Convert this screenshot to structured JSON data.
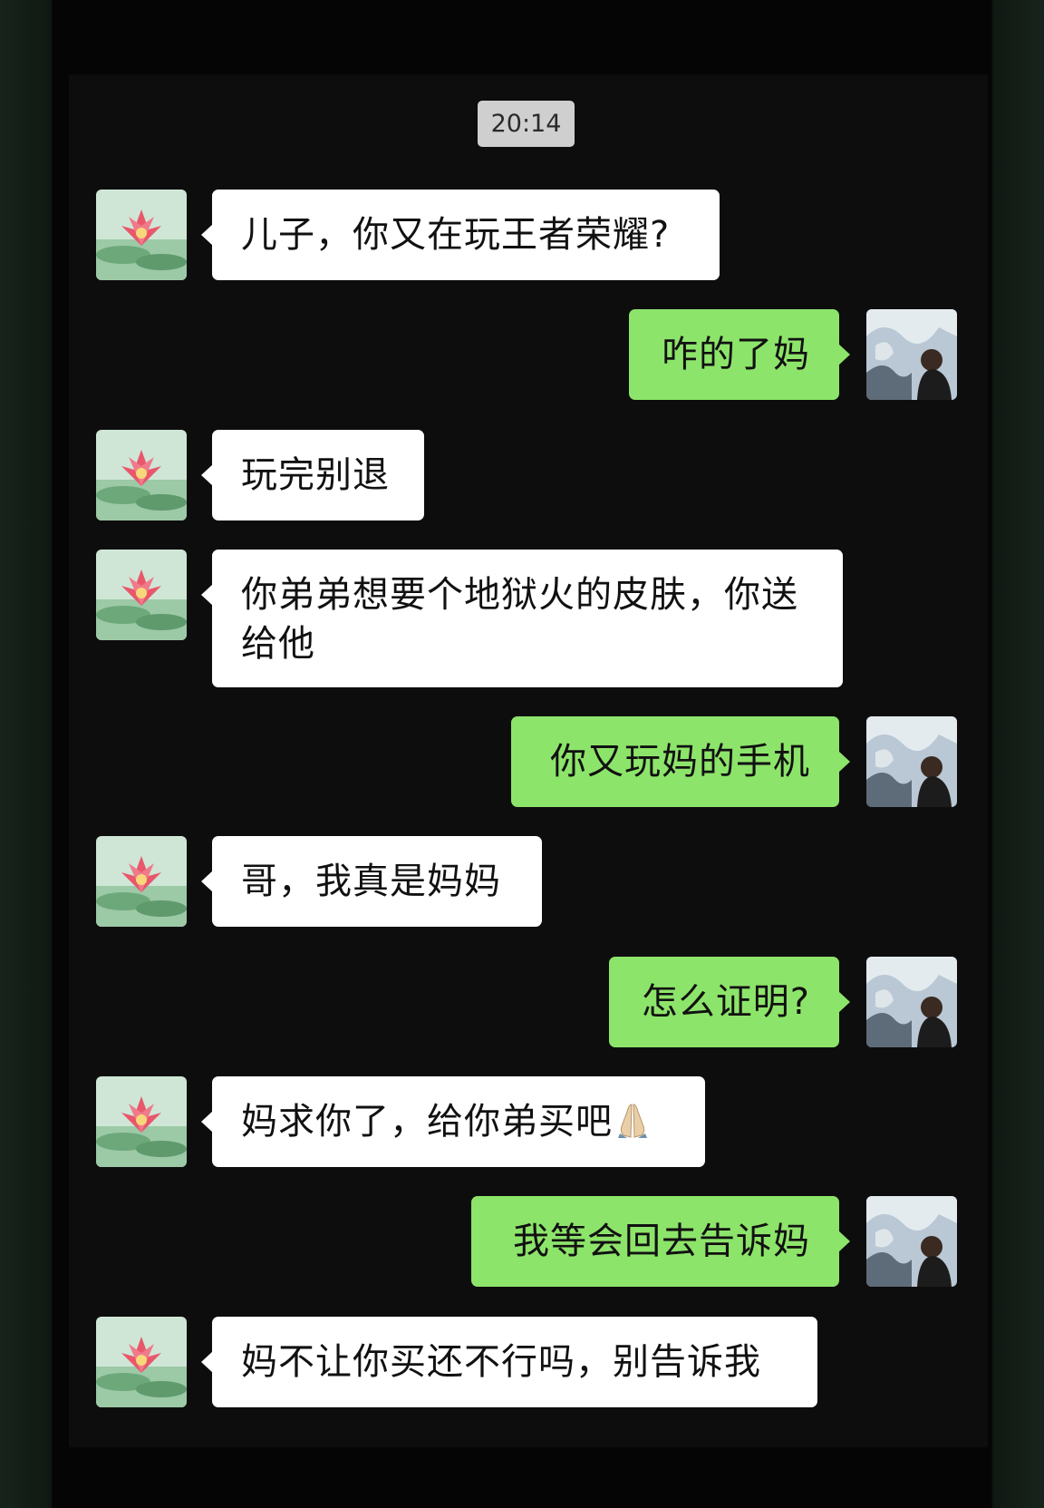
{
  "chat": {
    "timestamp": "20:14",
    "messages": [
      {
        "sender": "mom",
        "text": "儿子，你又在玩王者荣耀?"
      },
      {
        "sender": "me",
        "text": "咋的了妈"
      },
      {
        "sender": "mom",
        "text": "玩完别退"
      },
      {
        "sender": "mom",
        "text": "你弟弟想要个地狱火的皮肤，你送给他"
      },
      {
        "sender": "me",
        "text": "你又玩妈的手机"
      },
      {
        "sender": "mom",
        "text": "哥，我真是妈妈"
      },
      {
        "sender": "me",
        "text": "怎么证明?"
      },
      {
        "sender": "mom",
        "text": "妈求你了，给你弟买吧",
        "trailing_emoji": "folded-hands-icon"
      },
      {
        "sender": "me",
        "text": "我等会回去告诉妈"
      },
      {
        "sender": "mom",
        "text": "妈不让你买还不行吗，别告诉我"
      }
    ]
  },
  "colors": {
    "background": "#0d0d0d",
    "incoming_bubble": "#ffffff",
    "outgoing_bubble": "#8de46a",
    "time_badge": "#cfcfcf"
  }
}
